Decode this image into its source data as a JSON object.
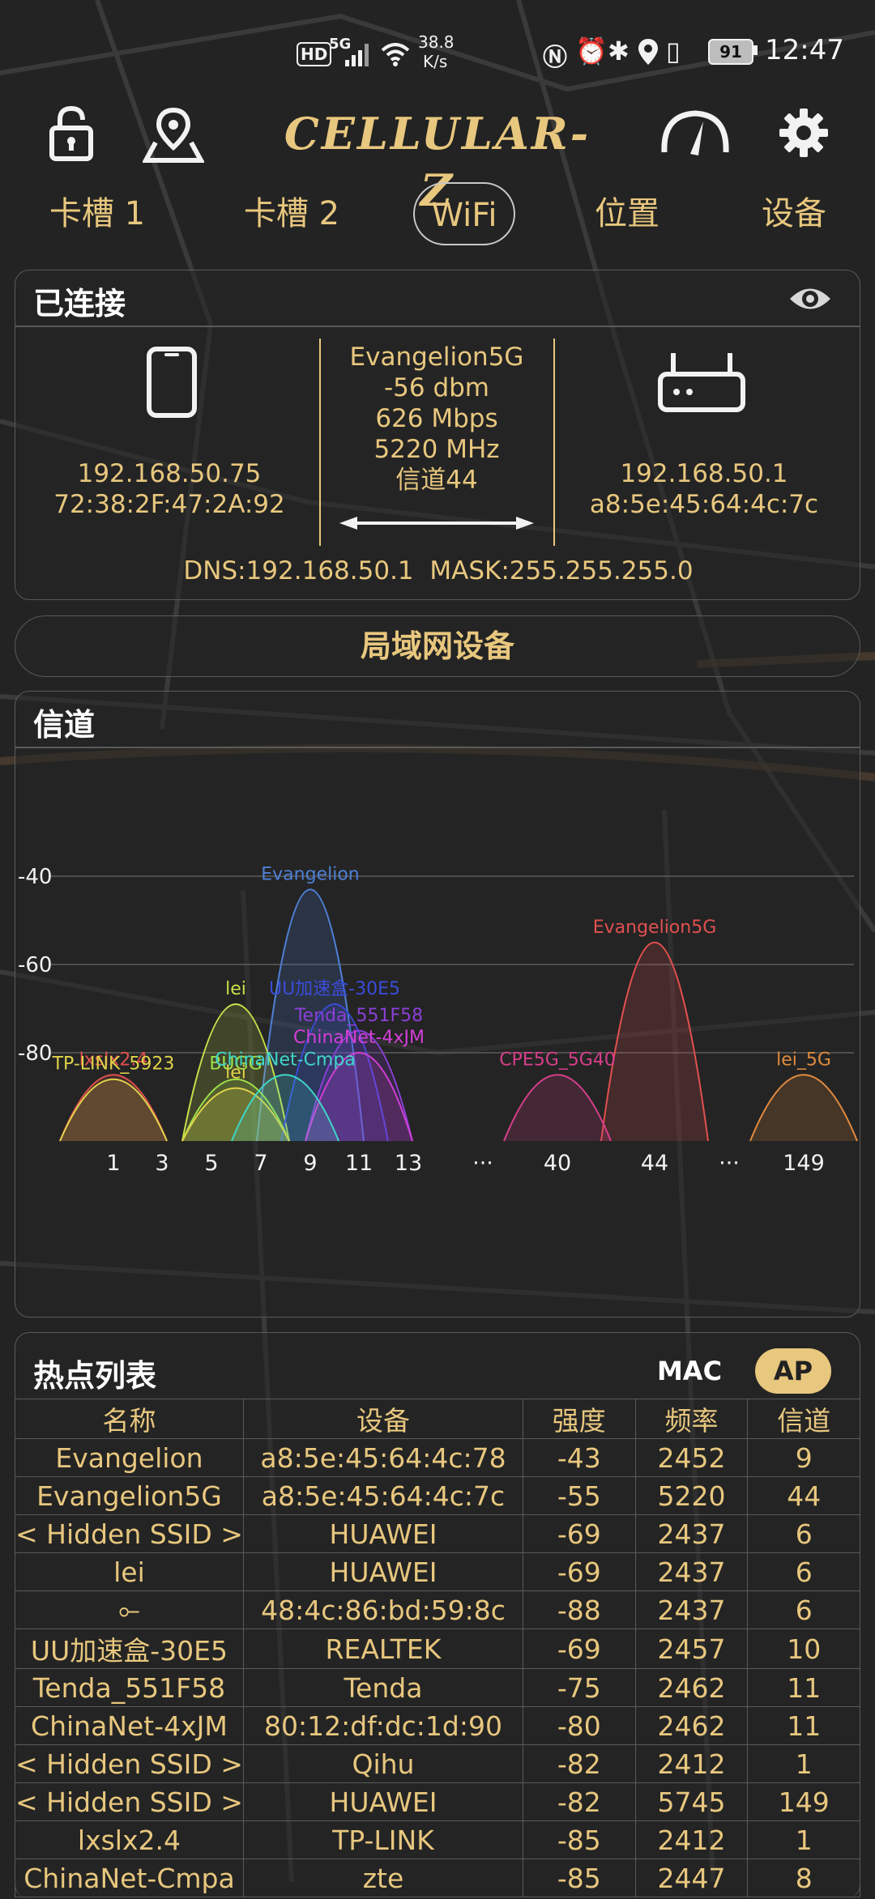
{
  "status_bar": {
    "hd": "HD",
    "net": "5G",
    "speed_value": "38.8",
    "speed_unit": "K/s",
    "battery": "91",
    "time": "12:47"
  },
  "top_bar": {
    "logo": "CELLULAR-Z"
  },
  "tabs": [
    "卡槽 1",
    "卡槽 2",
    "WiFi",
    "位置",
    "设备"
  ],
  "connected": {
    "title": "已连接",
    "device_ip": "192.168.50.75",
    "device_mac": "72:38:2F:47:2A:92",
    "ssid": "Evangelion5G",
    "signal": "-56 dbm",
    "speed": "626 Mbps",
    "freq": "5220 MHz",
    "channel": "信道44",
    "router_ip": "192.168.50.1",
    "router_mac": "a8:5e:45:64:4c:7c",
    "dns_mask": "DNS:192.168.50.1  MASK:255.255.255.0"
  },
  "lan_button": "局域网设备",
  "channel_panel": {
    "title": "信道"
  },
  "chart_data": {
    "type": "area",
    "y_ticks": [
      "-40",
      "-60",
      "-80"
    ],
    "x_ticks": [
      "1",
      "3",
      "5",
      "7",
      "9",
      "11",
      "13",
      "···",
      "40",
      "44",
      "···",
      "149"
    ],
    "ylim": [
      -100,
      -30
    ],
    "series": [
      {
        "name": "Evangelion",
        "channel": "9",
        "value": -43,
        "color": "#4f7fd6"
      },
      {
        "name": "Evangelion5G",
        "channel": "44",
        "value": -55,
        "color": "#e0504f"
      },
      {
        "name": "lei",
        "channel": "6",
        "value": -69,
        "color": "#c8e04a"
      },
      {
        "name": "UU加速盒-30E5",
        "channel": "10",
        "value": -69,
        "color": "#3a4cd8"
      },
      {
        "name": "Tenda_551F58",
        "channel": "11",
        "value": -75,
        "color": "#8a3fd6"
      },
      {
        "name": "ChinaNet-4xJM",
        "channel": "11",
        "value": -80,
        "color": "#d23fd6"
      },
      {
        "name": "lxslx2.4",
        "channel": "1",
        "value": -85,
        "color": "#e05050"
      },
      {
        "name": "TP-LINK_5923",
        "channel": "1",
        "value": -86,
        "color": "#e0d24a"
      },
      {
        "name": "BUGG",
        "channel": "6",
        "value": -86,
        "color": "#9fe04a"
      },
      {
        "name": "lei",
        "channel": "6",
        "value": -88,
        "color": "#e0d24a"
      },
      {
        "name": "ChinaNet-Cmpa",
        "channel": "8",
        "value": -85,
        "color": "#3fd6c8"
      },
      {
        "name": "CPE5G_5G40",
        "channel": "40",
        "value": -85,
        "color": "#d63f8a"
      },
      {
        "name": "lei_5G",
        "channel": "149",
        "value": -85,
        "color": "#e08a3f"
      }
    ]
  },
  "hotspot_panel": {
    "title": "热点列表",
    "mac_toggle": "MAC",
    "ap_toggle": "AP",
    "columns": [
      "名称",
      "设备",
      "强度",
      "频率",
      "信道"
    ],
    "rows": [
      [
        "Evangelion",
        "a8:5e:45:64:4c:78",
        "-43",
        "2452",
        "9"
      ],
      [
        "Evangelion5G",
        "a8:5e:45:64:4c:7c",
        "-55",
        "5220",
        "44"
      ],
      [
        "< Hidden SSID >",
        "HUAWEI",
        "-69",
        "2437",
        "6"
      ],
      [
        "lei",
        "HUAWEI",
        "-69",
        "2437",
        "6"
      ],
      [
        "⟜",
        "48:4c:86:bd:59:8c",
        "-88",
        "2437",
        "6"
      ],
      [
        "UU加速盒-30E5",
        "REALTEK",
        "-69",
        "2457",
        "10"
      ],
      [
        "Tenda_551F58",
        "Tenda",
        "-75",
        "2462",
        "11"
      ],
      [
        "ChinaNet-4xJM",
        "80:12:df:dc:1d:90",
        "-80",
        "2462",
        "11"
      ],
      [
        "< Hidden SSID >",
        "Qihu",
        "-82",
        "2412",
        "1"
      ],
      [
        "< Hidden SSID >",
        "HUAWEI",
        "-82",
        "5745",
        "149"
      ],
      [
        "lxslx2.4",
        "TP-LINK",
        "-85",
        "2412",
        "1"
      ],
      [
        "ChinaNet-Cmpa",
        "zte",
        "-85",
        "2447",
        "8"
      ]
    ]
  }
}
